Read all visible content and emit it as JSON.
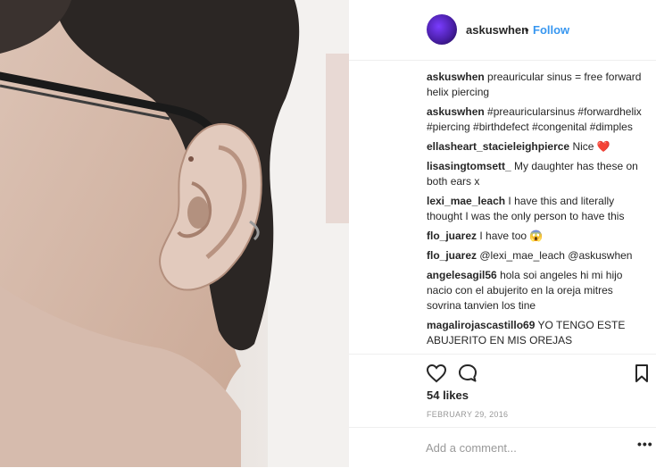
{
  "post": {
    "username": "askuswhen",
    "separator": "•",
    "follow_label": "Follow",
    "comments": [
      {
        "user": "askuswhen",
        "text": "preauricular sinus = free forward helix piercing"
      },
      {
        "user": "askuswhen",
        "text": "#preauricularsinus #forwardhelix #piercing #birthdefect #congenital #dimples"
      },
      {
        "user": "ellasheart_stacieleighpierce",
        "text": "Nice ❤️"
      },
      {
        "user": "lisasingtomsett_",
        "text": "My daughter has these on both ears x"
      },
      {
        "user": "lexi_mae_leach",
        "text": "I have this and literally thought I was the only person to have this"
      },
      {
        "user": "flo_juarez",
        "text": "I have too 😱"
      },
      {
        "user": "flo_juarez",
        "text": "@lexi_mae_leach @askuswhen"
      },
      {
        "user": "angelesagil56",
        "text": "hola soi angeles hi mi hijo nacio con el abujerito en la oreja mitres sovrina tanvien los tine"
      },
      {
        "user": "magalirojascastillo69",
        "text": "YO TENGO ESTE ABUJERITO EN MIS OREJAS"
      }
    ],
    "likes": "54 likes",
    "date": "FEBRUARY 29, 2016",
    "add_comment_placeholder": "Add a comment...",
    "more_label": "•••"
  },
  "icons": {
    "like": "heart-icon",
    "comment": "comment-bubble-icon",
    "save": "bookmark-icon"
  },
  "colors": {
    "follow": "#3897f0",
    "text": "#262626",
    "muted": "#999999",
    "hashtag": "#003569"
  }
}
